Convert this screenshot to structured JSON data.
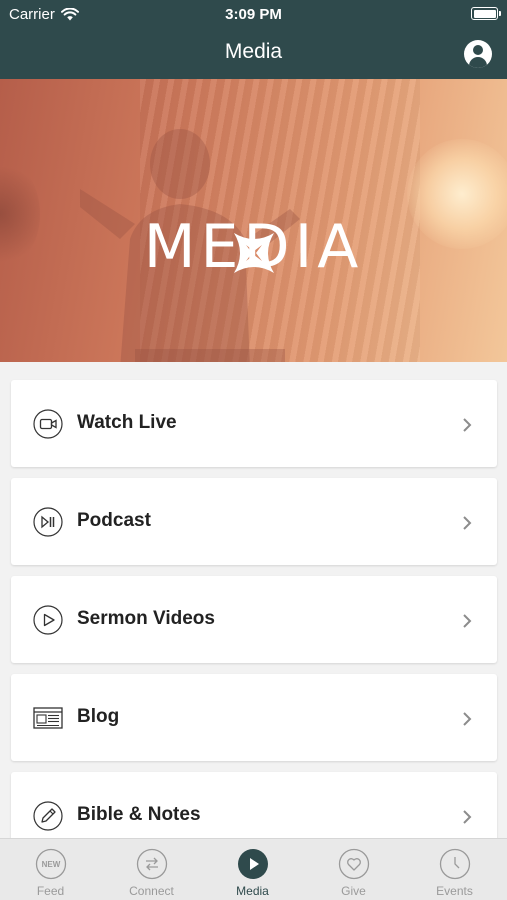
{
  "status_bar": {
    "carrier": "Carrier",
    "time": "3:09 PM"
  },
  "header": {
    "title": "Media"
  },
  "hero": {
    "title": "MEDIA"
  },
  "menu": [
    {
      "label": "Watch Live",
      "icon": "video-camera-icon"
    },
    {
      "label": "Podcast",
      "icon": "play-pause-icon"
    },
    {
      "label": "Sermon Videos",
      "icon": "play-circle-icon"
    },
    {
      "label": "Blog",
      "icon": "newspaper-icon"
    },
    {
      "label": "Bible & Notes",
      "icon": "pencil-icon"
    }
  ],
  "tabs": [
    {
      "label": "Feed",
      "badge": "NEW",
      "icon": "new-badge-icon"
    },
    {
      "label": "Connect",
      "icon": "arrows-exchange-icon"
    },
    {
      "label": "Media",
      "icon": "play-icon",
      "active": true
    },
    {
      "label": "Give",
      "icon": "heart-icon"
    },
    {
      "label": "Events",
      "icon": "clock-icon"
    }
  ],
  "colors": {
    "header_bg": "#2f4a4c",
    "accent": "#2f4a4c",
    "tab_inactive": "#9a9a9a"
  }
}
